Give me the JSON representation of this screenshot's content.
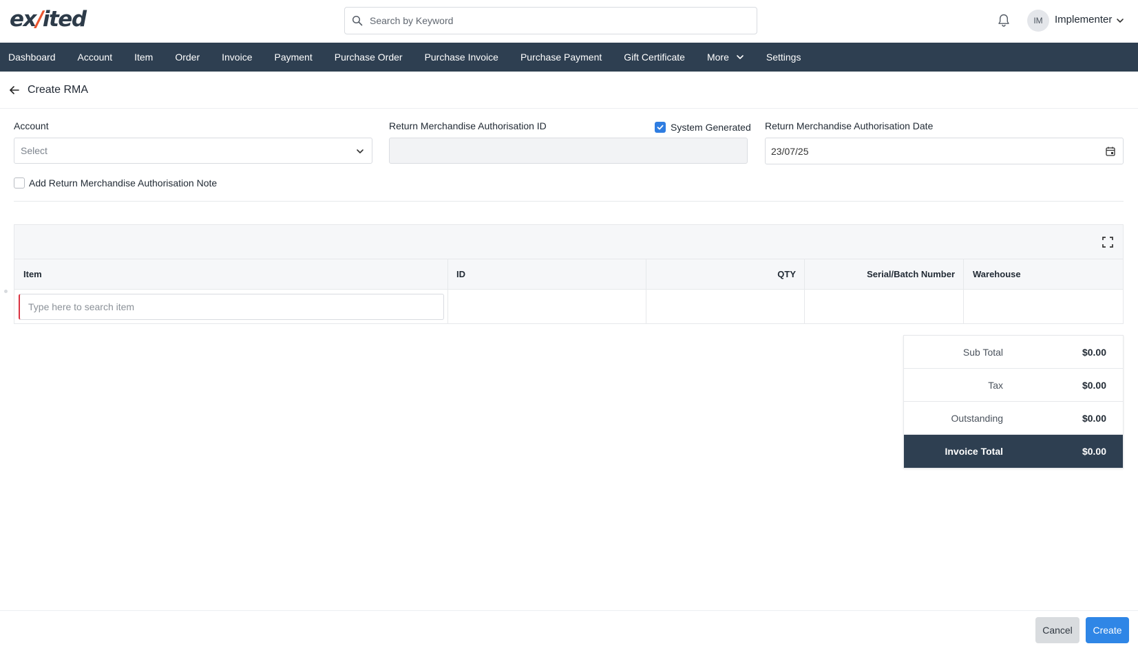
{
  "brand": {
    "logo_pre": "ex",
    "logo_mark": "/",
    "logo_post": "ited"
  },
  "header": {
    "search_placeholder": "Search by Keyword",
    "user_initials": "IM",
    "user_name": "Implementer"
  },
  "nav": {
    "items": [
      "Dashboard",
      "Account",
      "Item",
      "Order",
      "Invoice",
      "Payment",
      "Purchase Order",
      "Purchase Invoice",
      "Purchase Payment",
      "Gift Certificate",
      "More",
      "Settings"
    ]
  },
  "page": {
    "title": "Create RMA"
  },
  "form": {
    "account_label": "Account",
    "account_placeholder": "Select",
    "rma_id_label": "Return Merchandise Authorisation ID",
    "rma_id_value": "",
    "system_generated_label": "System Generated",
    "system_generated_checked": true,
    "rma_date_label": "Return Merchandise Authorisation Date",
    "rma_date_value": "23/07/25",
    "add_note_label": "Add Return Merchandise Authorisation Note",
    "add_note_checked": false
  },
  "table": {
    "columns": [
      "Item",
      "ID",
      "QTY",
      "Serial/Batch Number",
      "Warehouse"
    ],
    "item_search_placeholder": "Type here to search item"
  },
  "totals": {
    "sub_total_label": "Sub Total",
    "sub_total": "$0.00",
    "tax_label": "Tax",
    "tax": "$0.00",
    "outstanding_label": "Outstanding",
    "outstanding": "$0.00",
    "invoice_total_label": "Invoice Total",
    "invoice_total": "$0.00"
  },
  "footer": {
    "cancel_label": "Cancel",
    "create_label": "Create"
  },
  "colors": {
    "nav_bg": "#2e3f51",
    "primary": "#2f86e6",
    "brand_accent": "#e8552f",
    "required": "#d93240"
  },
  "icons": [
    "search-icon",
    "bell-icon",
    "chevron-down-icon",
    "back-arrow-icon",
    "calendar-icon",
    "checkmark-icon",
    "expand-icon"
  ]
}
